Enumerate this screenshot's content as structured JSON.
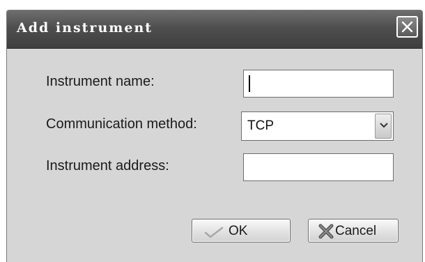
{
  "dialog": {
    "title": "Add instrument",
    "close_icon": "close-icon"
  },
  "form": {
    "name_label": "Instrument name:",
    "name_value": "",
    "method_label": "Communication method:",
    "method_value": "TCP",
    "method_arrow_icon": "chevron-down-icon",
    "address_label": "Instrument address:",
    "address_value": ""
  },
  "buttons": {
    "ok_label": "OK",
    "ok_icon": "checkmark-icon",
    "cancel_label": "Cancel",
    "cancel_icon": "x-mark-icon"
  }
}
